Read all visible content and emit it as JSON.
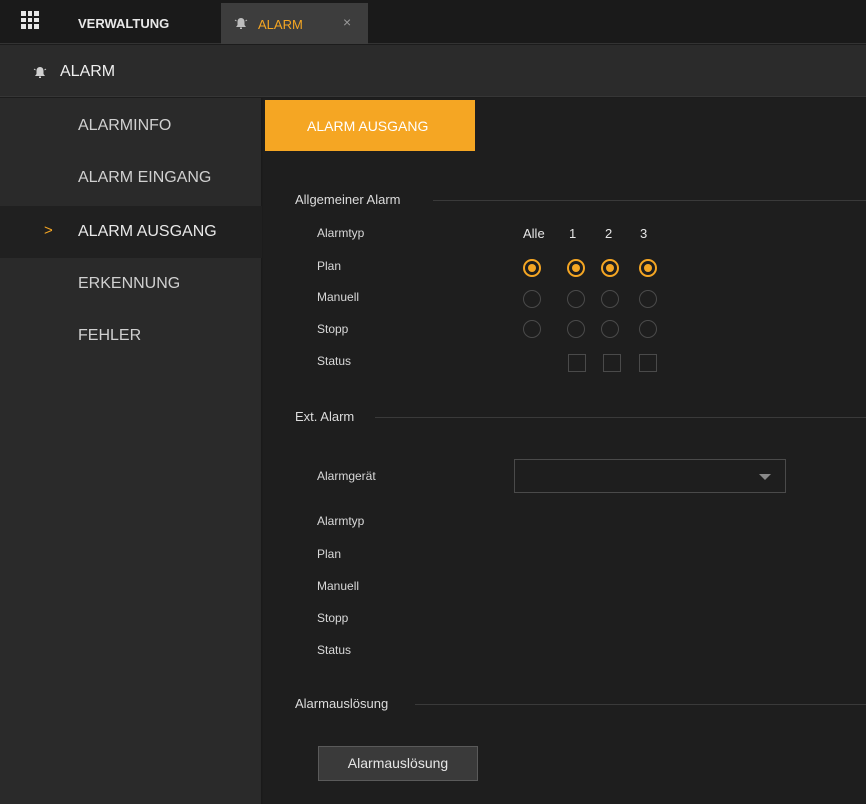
{
  "topbar": {
    "menu_icon": "grid-icon",
    "tabs": [
      {
        "label": "VERWALTUNG"
      },
      {
        "label": "ALARM",
        "icon": "bell-icon",
        "close": "×"
      }
    ]
  },
  "header": {
    "title": "ALARM",
    "icon": "bell-icon"
  },
  "sidebar": {
    "items": [
      {
        "label": "ALARMINFO"
      },
      {
        "label": "ALARM EINGANG"
      },
      {
        "label": "ALARM AUSGANG",
        "active": true,
        "chevron": ">"
      },
      {
        "label": "ERKENNUNG"
      },
      {
        "label": "FEHLER"
      }
    ]
  },
  "main": {
    "subtab": {
      "label": "ALARM AUSGANG"
    },
    "general": {
      "title": "Allgemeiner Alarm",
      "rows": {
        "alarmtyp": "Alarmtyp",
        "plan": "Plan",
        "manuell": "Manuell",
        "stopp": "Stopp",
        "status": "Status"
      },
      "columns": [
        "Alle",
        "1",
        "2",
        "3"
      ],
      "selected_mode": "Plan"
    },
    "external": {
      "title": "Ext. Alarm",
      "device_label": "Alarmgerät",
      "device_value": "",
      "rows": {
        "alarmtyp": "Alarmtyp",
        "plan": "Plan",
        "manuell": "Manuell",
        "stopp": "Stopp",
        "status": "Status"
      }
    },
    "trigger": {
      "title": "Alarmauslösung",
      "button": "Alarmauslösung"
    }
  },
  "colors": {
    "accent": "#f5a623",
    "background": "#1e1e1e",
    "sidebar": "#2a2a2a"
  }
}
